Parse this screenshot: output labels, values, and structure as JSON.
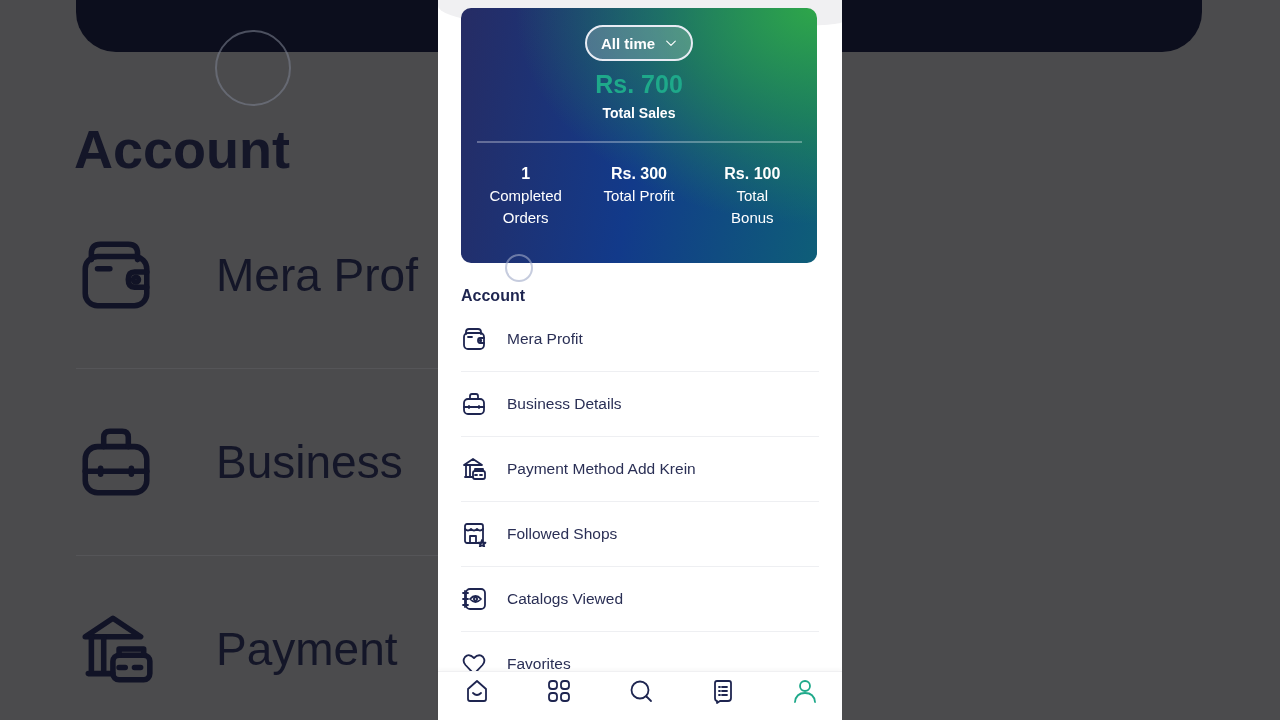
{
  "backdrop": {
    "heading": "Account",
    "items": [
      "Mera Prof",
      "Business",
      "Payment"
    ]
  },
  "summary": {
    "period": "All time",
    "total_sales": "Rs. 700",
    "total_sales_label": "Total Sales",
    "stats": [
      {
        "value": "1",
        "label": "Completed Orders"
      },
      {
        "value": "Rs. 300",
        "label": "Total Profit"
      },
      {
        "value": "Rs. 100",
        "label": "Total Bonus"
      }
    ]
  },
  "account": {
    "heading": "Account",
    "items": [
      "Mera Profit",
      "Business Details",
      "Payment Method Add Krein",
      "Followed Shops",
      "Catalogs Viewed",
      "Favorites"
    ]
  },
  "nav": [
    {
      "selected": false
    },
    {
      "selected": false
    },
    {
      "selected": false
    },
    {
      "selected": false
    },
    {
      "selected": true
    }
  ]
}
